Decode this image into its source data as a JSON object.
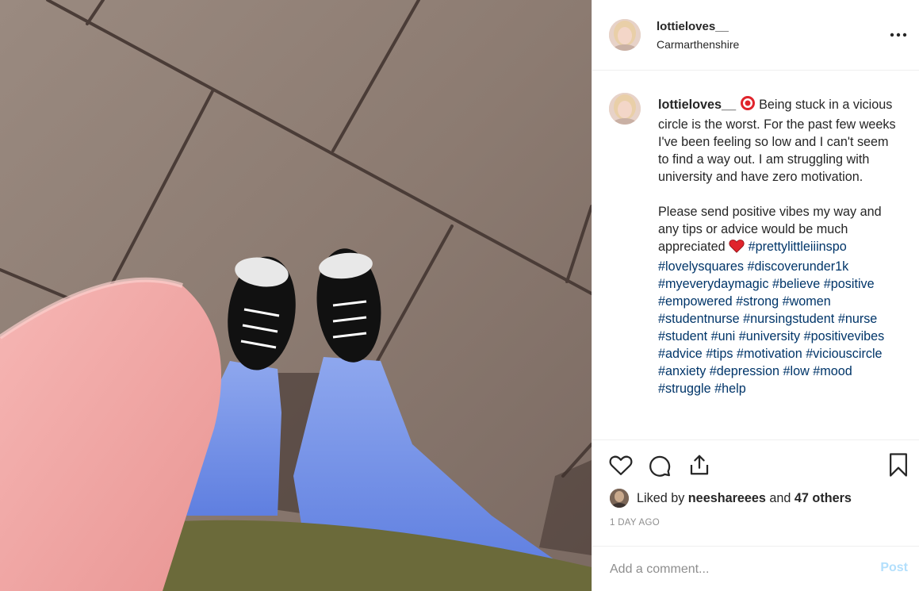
{
  "post": {
    "username": "lottieloves__",
    "location": "Carmarthenshire",
    "more_icon": "more-horizontal-icon"
  },
  "caption": {
    "username": "lottieloves__",
    "emoji_1": "target-emoji",
    "text_1": " Being stuck in a vicious circle is the worst. For the past few weeks I've been feeling so low and I can't seem to find a way out. I am struggling with university and have zero motivation.",
    "text_2": "Please send positive vibes my way and any tips or advice would be much appreciated ",
    "emoji_2": "red-heart-emoji",
    "hashtags": [
      "#prettylittleiiinspo",
      "#lovelysquares",
      "#discoverunder1k",
      "#myeverydaymagic",
      "#believe",
      "#positive",
      "#empowered",
      "#strong",
      "#women",
      "#studentnurse",
      "#nursingstudent",
      "#nurse",
      "#student",
      "#uni",
      "#university",
      "#positivevibes",
      "#advice",
      "#tips",
      "#motivation",
      "#viciouscircle",
      "#anxiety",
      "#depression",
      "#low",
      "#mood",
      "#struggle",
      "#help"
    ]
  },
  "actions": {
    "like_icon": "heart-icon",
    "comment_icon": "comment-icon",
    "share_icon": "share-icon",
    "save_icon": "bookmark-icon"
  },
  "likes": {
    "prefix": "Liked by ",
    "user": "neeshareees",
    "middle": " and ",
    "others": "47 others"
  },
  "date": "1 DAY AGO",
  "comment": {
    "placeholder": "Add a comment...",
    "post_label": "Post"
  },
  "colors": {
    "hashtag": "#003569",
    "post_disabled": "#b2dffc",
    "heart_red": "#ed4956"
  }
}
